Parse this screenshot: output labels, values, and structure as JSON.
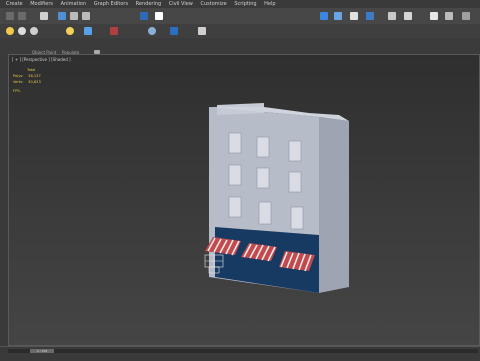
{
  "menu": [
    "Create",
    "Modifiers",
    "Animation",
    "Graph Editors",
    "Rendering",
    "Civil View",
    "Customize",
    "Scripting",
    "Help"
  ],
  "ribbon_tabs": [
    "Object Paint",
    "Populate"
  ],
  "viewport": {
    "label": "[ + ] [Perspective ] [Shaded ]",
    "stats": {
      "header": "Total",
      "polys_label": "Polys:",
      "polys_value": "38,137",
      "verts_label": "Verts:",
      "verts_value": "30,623"
    },
    "fps_label": "FPS:"
  },
  "timeline": {
    "thumb_label": "0 / 100"
  },
  "colors": {
    "building": "#b7bcc9",
    "storefront": "#173a63",
    "awning_red": "#c24a4f",
    "awning_white": "#f1e9e6"
  },
  "icons": [
    "undo-icon",
    "redo-icon",
    "select-icon",
    "move-icon",
    "rotate-icon",
    "scale-icon",
    "render-icon",
    "light-icon",
    "camera-icon"
  ]
}
